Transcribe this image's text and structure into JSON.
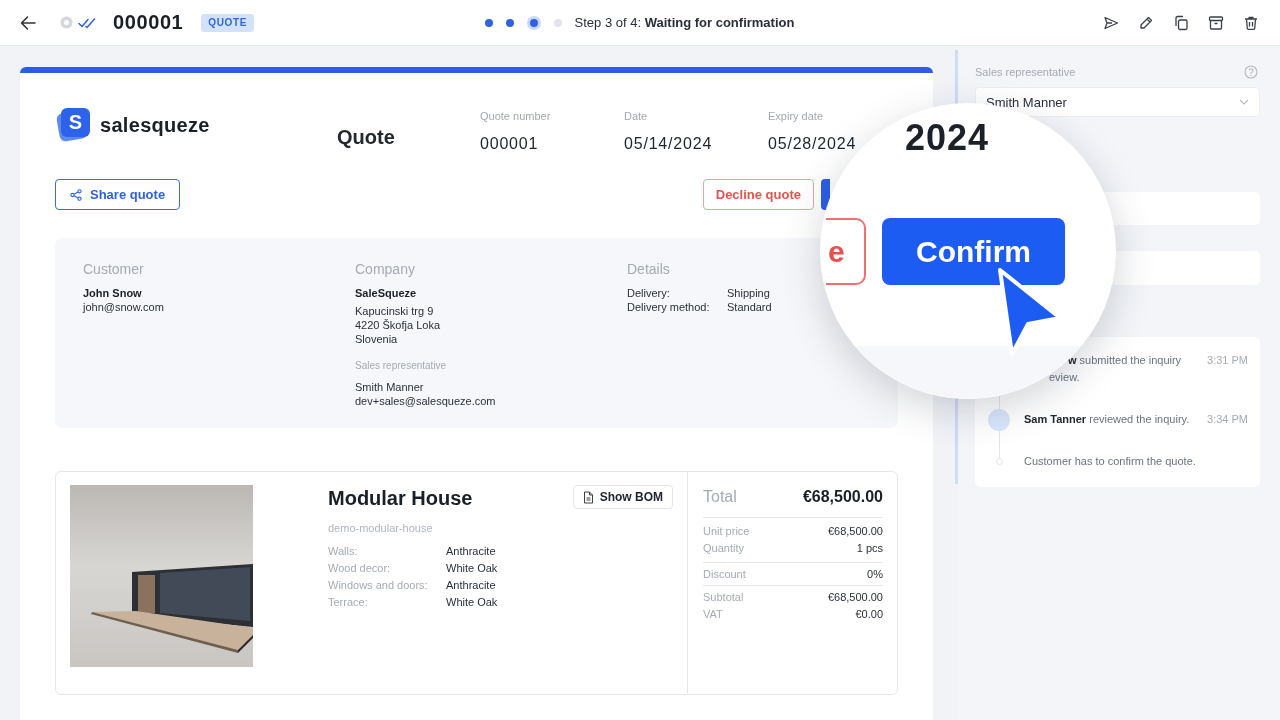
{
  "top_bar": {
    "document_number": "000001",
    "badge": "QUOTE",
    "steps": [
      {
        "done": true,
        "current": false
      },
      {
        "done": true,
        "current": false
      },
      {
        "done": false,
        "current": true
      },
      {
        "done": false,
        "current": false
      }
    ],
    "step_text": "Step 3 of 4: **Waiting for confirmation**"
  },
  "quote": {
    "logo_mark": "S",
    "brand": "salesqueze",
    "title": "Quote",
    "meta": [
      {
        "label": "Quote number",
        "value": "000001"
      },
      {
        "label": "Date",
        "value": "05/14/2024"
      },
      {
        "label": "Expiry date",
        "value": "05/28/2024"
      }
    ],
    "share_button": "Share quote",
    "decline_button": "Decline quote",
    "customer": {
      "heading": "Customer",
      "name": "John Snow",
      "email": "john@snow.com"
    },
    "company": {
      "heading": "Company",
      "name": "SaleSqueze",
      "address": [
        "Kapucinski trg 9",
        "4220 Škofja Loka",
        "Slovenia"
      ],
      "rep_label": "Sales representative",
      "rep_name": "Smith Manner",
      "rep_email": "dev+sales@salesqueze.com"
    },
    "details": {
      "heading": "Details",
      "rows": [
        {
          "label": "Delivery:",
          "value": "Shipping"
        },
        {
          "label": "Delivery method:",
          "value": "Standard"
        }
      ]
    }
  },
  "product": {
    "name": "Modular House",
    "bom_button": "Show BOM",
    "slug": "demo-modular-house",
    "attributes": [
      {
        "label": "Walls:",
        "value": "Anthracite"
      },
      {
        "label": "Wood decor:",
        "value": "White Oak"
      },
      {
        "label": "Windows and doors:",
        "value": "Anthracite"
      },
      {
        "label": "Terrace:",
        "value": "White Oak"
      }
    ],
    "total_label": "Total",
    "total": "€68,500.00",
    "price_groups": [
      {
        "rows": [
          {
            "label": "Unit price",
            "value": "€68,500.00"
          },
          {
            "label": "Quantity",
            "value": "1 pcs"
          }
        ]
      },
      {
        "rows": [
          {
            "label": "Discount",
            "value": "0%"
          }
        ]
      },
      {
        "rows": [
          {
            "label": "Subtotal",
            "value": "€68,500.00"
          },
          {
            "label": "VAT",
            "value": "€0.00"
          }
        ]
      }
    ]
  },
  "side_panel": {
    "field_label": "Sales representative",
    "field_value": "Smith Manner",
    "activity": [
      {
        "lines": [
          "**w** submitted the inquiry",
          "eview."
        ],
        "time": "3:31 PM"
      },
      {
        "lines": [
          "**Sam Tanner** reviewed the inquiry."
        ],
        "time": "3:34 PM",
        "active": true
      },
      {
        "lines": [
          "Customer has to confirm the quote."
        ],
        "active": false
      }
    ]
  },
  "magnifier": {
    "year": "2024",
    "button_fragment": "e",
    "confirm_button": "Confirm"
  }
}
